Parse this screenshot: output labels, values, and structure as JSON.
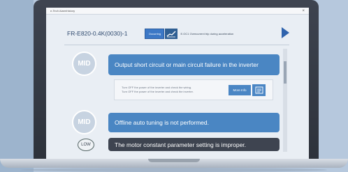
{
  "window": {
    "title": "e-Tech Alarmhistory",
    "close_glyph": "×"
  },
  "header": {
    "model": "FR-E820-0.4K(0030)-1",
    "state_button": "Occurring",
    "alarm_text": "E.OC1 Overcurrent trip during acceleration",
    "next_icon": "chevron-right-icon"
  },
  "causes": [
    {
      "level": "MID",
      "text": "Output short circuit or main circuit failure in the inverter"
    },
    {
      "level": "MID",
      "text": "Offline auto tuning is not performed."
    },
    {
      "level": "LOW",
      "text": "The motor constant parameter setting is improper."
    }
  ],
  "check": {
    "line1": "Turn OFF the power of the inverter and check the wiring.",
    "line2": "Turn OFF the power of the inverter and check the inverter.",
    "more_label": "More Info"
  },
  "colors": {
    "accent": "#4a86c3",
    "dark_row": "#3e4450",
    "arrow": "#2f63ad"
  }
}
